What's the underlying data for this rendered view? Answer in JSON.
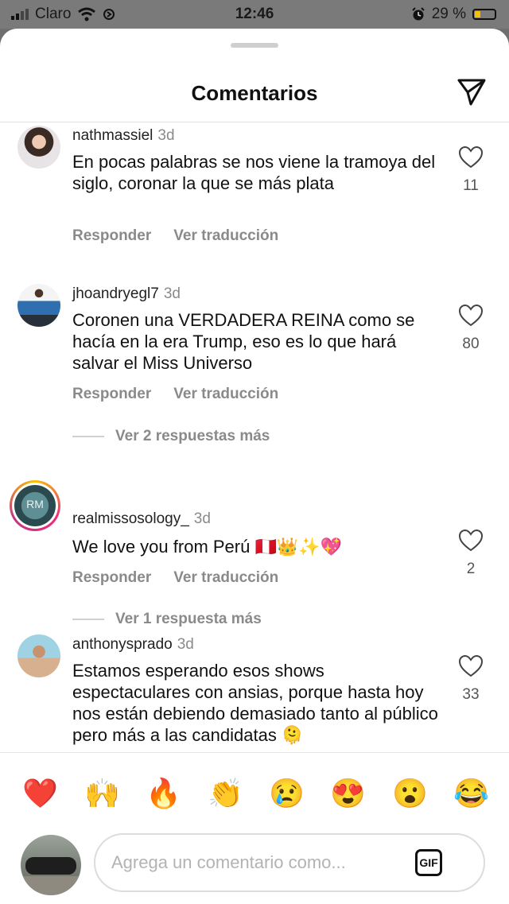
{
  "status": {
    "carrier": "Claro",
    "time": "12:46",
    "battery": "29 %",
    "battery_level": 0.29
  },
  "header": {
    "title": "Comentarios",
    "icon": "send-icon"
  },
  "comments": [
    {
      "username": "nathmassiel",
      "time": "3d",
      "text": "En pocas palabras se nos viene la tramoya del siglo, coronar la que se más plata",
      "reply_label": "Responder",
      "translate_label": "Ver traducción",
      "likes": "11"
    },
    {
      "username": "jhoandryegl7",
      "time": "3d",
      "text": "Coronen una VERDADERA REINA como se hacía en la era Trump, eso es lo que hará salvar el Miss Universo",
      "reply_label": "Responder",
      "translate_label": "Ver traducción",
      "likes": "80",
      "replies_label": "Ver 2 respuestas más"
    },
    {
      "username": "realmissosology_",
      "time": "3d",
      "text": "We love you from Perú 🇵🇪👑✨💖",
      "reply_label": "Responder",
      "translate_label": "Ver traducción",
      "likes": "2",
      "replies_label": "Ver 1 respuesta más",
      "avatar_text": "RM"
    },
    {
      "username": "anthonysprado",
      "time": "3d",
      "text": "Estamos esperando esos shows espectaculares con ansias, porque hasta hoy nos están debiendo demasiado tanto al público pero más a las candidatas 🫠",
      "likes": "33"
    }
  ],
  "emoji_bar": [
    "❤️",
    "🙌",
    "🔥",
    "👏",
    "😢",
    "😍",
    "😮",
    "😂"
  ],
  "composer": {
    "placeholder": "Agrega un comentario como...",
    "gif_label": "GIF"
  }
}
